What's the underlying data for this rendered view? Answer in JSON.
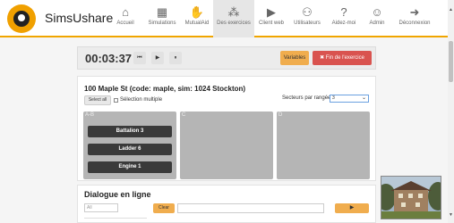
{
  "app": {
    "brand": "SimsUshare"
  },
  "nav": {
    "items": [
      {
        "label": "Accueil",
        "icon": "home-icon",
        "glyph": "⌂"
      },
      {
        "label": "Simulations",
        "icon": "map-icon",
        "glyph": "▦"
      },
      {
        "label": "MutualAid",
        "icon": "handshake-icon",
        "glyph": "✋"
      },
      {
        "label": "Des exercices",
        "icon": "sitemap-icon",
        "glyph": "⁂"
      },
      {
        "label": "Client web",
        "icon": "play-icon",
        "glyph": "▶"
      },
      {
        "label": "Utilisateurs",
        "icon": "users-icon",
        "glyph": "⚇"
      },
      {
        "label": "Aidez-moi",
        "icon": "question-icon",
        "glyph": "?"
      },
      {
        "label": "Admin",
        "icon": "user-circle-icon",
        "glyph": "☺"
      },
      {
        "label": "Déconnexion",
        "icon": "sign-out-icon",
        "glyph": "➜"
      }
    ],
    "active": "Des exercices"
  },
  "timer_bar": {
    "time": "00:03:37",
    "controls": [
      "⏮",
      "▶",
      "⏸"
    ],
    "variables_label": "Variables",
    "end_label": "✖ Fin de l'exercice"
  },
  "incident": {
    "title": "100 Maple St (code: maple, sim: 1024 Stockton)",
    "select_all_label": "Select all",
    "multi_select_label": "Sélection multiple",
    "sectors_per_row_label": "Secteurs par rangée",
    "sectors_per_row_value": "3",
    "sectors": [
      {
        "label": "A-B",
        "units": [
          "Battalion 3",
          "Ladder 6",
          "Engine 1"
        ]
      },
      {
        "label": "C",
        "units": []
      },
      {
        "label": "D",
        "units": []
      }
    ]
  },
  "dialogue": {
    "title": "Dialogue en ligne",
    "filter_value": "All",
    "clear_label": "Clear",
    "send_label": "▶"
  },
  "colors": {
    "accent": "#f0ad4e",
    "danger": "#d9534f",
    "unit_bg": "#3a3a3a",
    "sector_bg": "#b5b5b5"
  }
}
